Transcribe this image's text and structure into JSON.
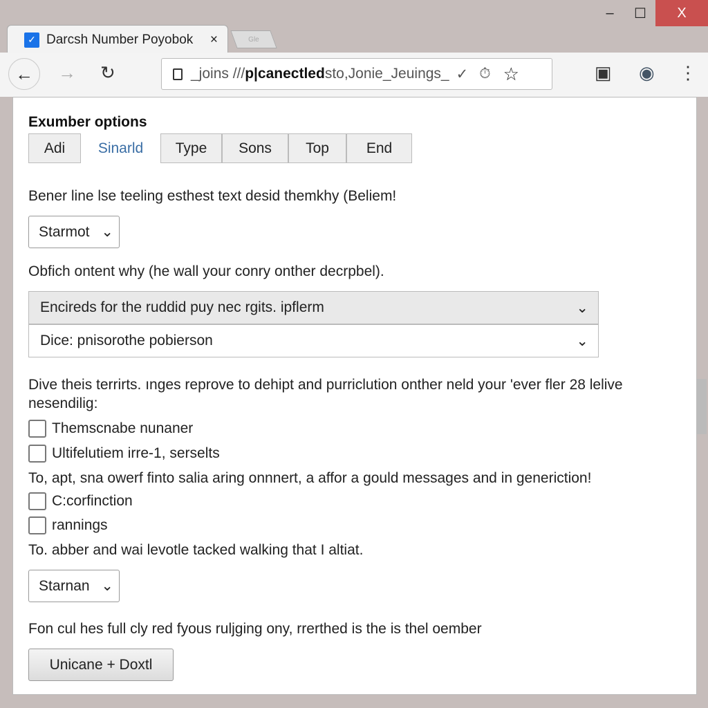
{
  "window": {
    "minimize": "–",
    "maximize": "☐",
    "close": "X"
  },
  "tab": {
    "title": "Darcsh Number Poyobok",
    "close": "×",
    "favicon": "✓",
    "new_tab": "Gle"
  },
  "toolbar": {
    "back": "←",
    "forward": "→",
    "reload": "↻",
    "url_pre": "_joins ///",
    "url_bold": "p|canectled",
    "url_post": " sto,Jonie_Jeuings_",
    "url_check": "✓",
    "url_history": "⏱",
    "star": "☆",
    "ext1": "▣",
    "ext2": "◉",
    "menu": "⋮"
  },
  "page": {
    "heading": "Exumber options",
    "tabs": [
      "Adi",
      "Sinarld",
      "Type",
      "Sons",
      "Top",
      "End"
    ],
    "p1": "Bener line lse teeling esthest text desid themkhy (Beliem!",
    "select1": "Starmot",
    "p2": "Obfich ontent why (he wall your conry onther decrpbel).",
    "accordion": [
      "Encireds for the ruddid puy nec rgits. ipflerm",
      "Dice: pnisorothe pobierson"
    ],
    "p3a": "Dive theis terrirts. ınges reprove to dehipt and purriclution onther neld your 'ever fler 28 lelive",
    "p3b": "nesendilig:",
    "checks1": [
      "Themscnabe nunaner",
      "Ultifelutiem irre-1, serselts"
    ],
    "p4": "To, apt, sna owerf finto salia aring onnnert, a affor a gould messages and in generiction!",
    "checks2": [
      "C:corfinction",
      "rannings"
    ],
    "p5": "To. abber and wai levotle tacked walking that I altiat.",
    "select2": "Starnan",
    "p6": "Fon cul hes full cly red fyous ruljging ony, rrerthed is the is thel oember",
    "button": "Unicane + Doxtl"
  }
}
